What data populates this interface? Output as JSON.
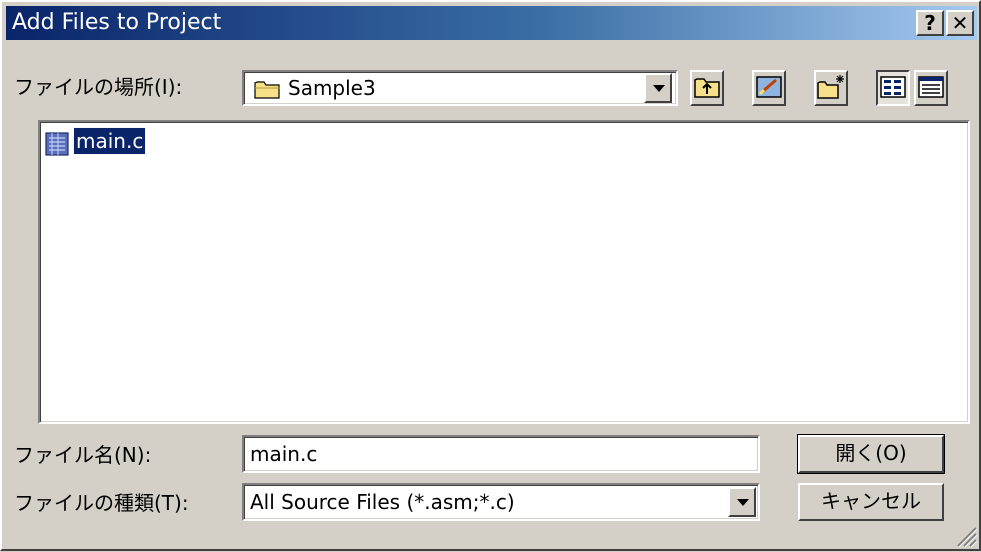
{
  "window": {
    "title": "Add Files to Project",
    "help_label": "?",
    "close_label": "✕"
  },
  "location": {
    "label": "ファイルの場所(I):",
    "value": "Sample3"
  },
  "toolbar": {
    "icons": [
      "up-folder-icon",
      "desktop-icon",
      "new-folder-icon",
      "list-view-icon",
      "details-view-icon"
    ]
  },
  "files": [
    {
      "name": "main.c",
      "icon": "c-source-file-icon",
      "selected": true
    }
  ],
  "filename": {
    "label": "ファイル名(N):",
    "value": "main.c"
  },
  "filetype": {
    "label": "ファイルの種類(T):",
    "value": "All Source Files (*.asm;*.c)"
  },
  "buttons": {
    "open": "開く(O)",
    "cancel": "キャンセル"
  },
  "colors": {
    "titlebar_start": "#0a246a",
    "titlebar_end": "#a6caf0",
    "face": "#d4d0c8",
    "selection": "#0a246a"
  }
}
